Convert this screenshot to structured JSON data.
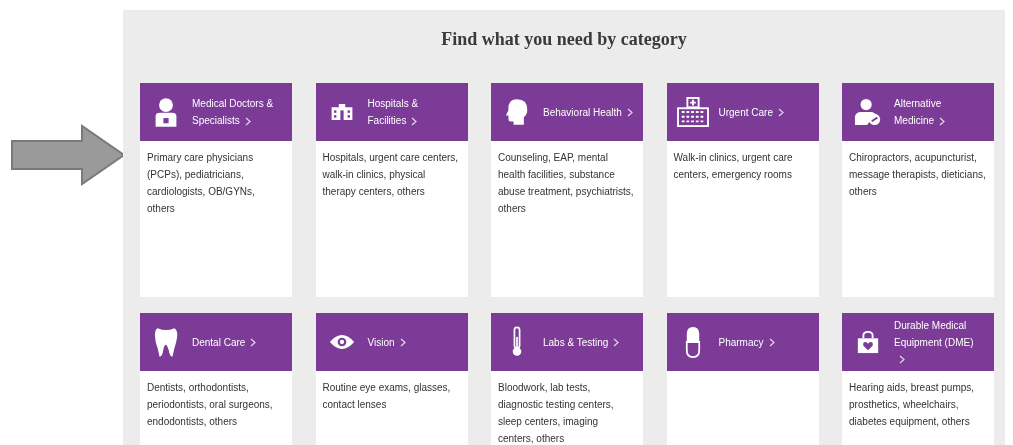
{
  "heading": "Find what you need by category",
  "categories": [
    {
      "title": "Medical Doctors & Specialists",
      "description": "Primary care physicians (PCPs), pediatricians, cardiologists, OB/GYNs, others"
    },
    {
      "title": "Hospitals & Facilities",
      "description": "Hospitals, urgent care centers, walk-in clinics, physical therapy centers, others"
    },
    {
      "title": "Behavioral Health",
      "description": "Counseling, EAP, mental health facilities, substance abuse treatment, psychiatrists, others"
    },
    {
      "title": "Urgent Care",
      "description": "Walk-in clinics, urgent care centers, emergency rooms"
    },
    {
      "title": "Alternative Medicine",
      "description": "Chiropractors, acupuncturist, message therapists, dieticians, others"
    },
    {
      "title": "Dental Care",
      "description": "Dentists, orthodontists, periodontists, oral surgeons, endodontists, others"
    },
    {
      "title": "Vision",
      "description": "Routine eye exams, glasses, contact lenses"
    },
    {
      "title": "Labs & Testing",
      "description": "Bloodwork, lab tests, diagnostic testing centers, sleep centers, imaging centers, others"
    },
    {
      "title": "Pharmacy"
    },
    {
      "title": "Durable Medical Equipment (DME)",
      "description": "Hearing aids, breast pumps, prosthetics, wheelchairs, diabetes equipment, others"
    }
  ]
}
